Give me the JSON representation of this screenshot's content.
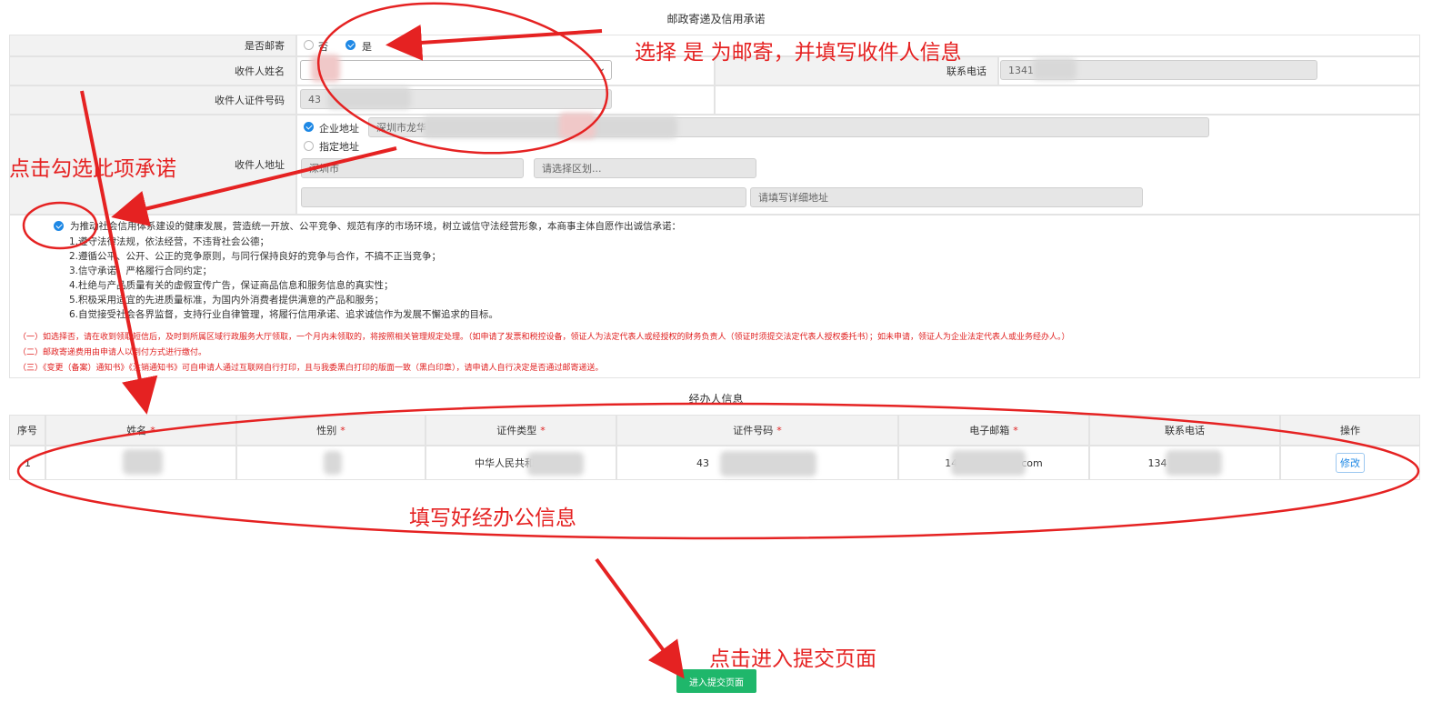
{
  "mail_section": {
    "title": "邮政寄递及信用承诺",
    "is_mail_label": "是否邮寄",
    "opt_no": "否",
    "opt_yes": "是",
    "recipient_name_label": "收件人姓名",
    "phone_label": "联系电话",
    "phone_value": "1341",
    "id_label": "收件人证件号码",
    "id_value": "43",
    "address_label": "收件人地址",
    "addr_opt_company": "企业地址",
    "addr_opt_company_value": "深圳市龙华",
    "addr_opt_specified": "指定地址",
    "city_value": "深圳市",
    "district_placeholder": "请选择区划...",
    "detail_placeholder": "请填写详细地址"
  },
  "promise": {
    "intro": "为推动社会信用体系建设的健康发展，营造统一开放、公平竞争、规范有序的市场环境，树立诚信守法经营形象，本商事主体自愿作出诚信承诺：",
    "items": [
      "1.遵守法律法规，依法经营，不违背社会公德；",
      "2.遵循公平、公开、公正的竞争原则，与同行保持良好的竞争与合作，不搞不正当竞争；",
      "3.信守承诺，严格履行合同约定；",
      "4.杜绝与产品质量有关的虚假宣传广告，保证商品信息和服务信息的真实性；",
      "5.积极采用适宜的先进质量标准，为国内外消费者提供满意的产品和服务；",
      "6.自觉接受社会各界监督，支持行业自律管理，将履行信用承诺、追求诚信作为发展不懈追求的目标。"
    ],
    "notes": [
      "（一）如选择否，请在收到领取短信后，及时到所属区域行政服务大厅领取，一个月内未领取的，将按照相关管理规定处理。（如申请了发票和税控设备，领证人为法定代表人或经授权的财务负责人（领证时须提交法定代表人授权委托书）；如未申请，领证人为企业法定代表人或业务经办人。）",
      "（二）邮政寄递费用由申请人以到付方式进行缴付。",
      "（三）《变更（备案）通知书》《注销通知书》可自申请人通过互联网自行打印，且与我委黑白打印的版面一致（黑白印章），请申请人自行决定是否通过邮寄递送。"
    ]
  },
  "agent_section": {
    "title": "经办人信息",
    "columns": [
      "序号",
      "姓名",
      "性别",
      "证件类型",
      "证件号码",
      "电子邮箱",
      "联系电话",
      "操作"
    ],
    "row": {
      "index": "1",
      "id_type": "中华人民共和",
      "id_number": "43",
      "email_prefix": "14",
      "email_suffix": "com",
      "phone": "134",
      "action": "修改"
    }
  },
  "submit_label": "进入提交页面",
  "annotations": {
    "select_yes": "选择 是 为邮寄，并填写收件人信息",
    "tick_promise": "点击勾选此项承诺",
    "fill_agent": "填写好经办公信息",
    "click_submit": "点击进入提交页面"
  },
  "colors": {
    "annotation_red": "#e52222",
    "primary_blue": "#1e88e5",
    "submit_green": "#1fb76b"
  }
}
